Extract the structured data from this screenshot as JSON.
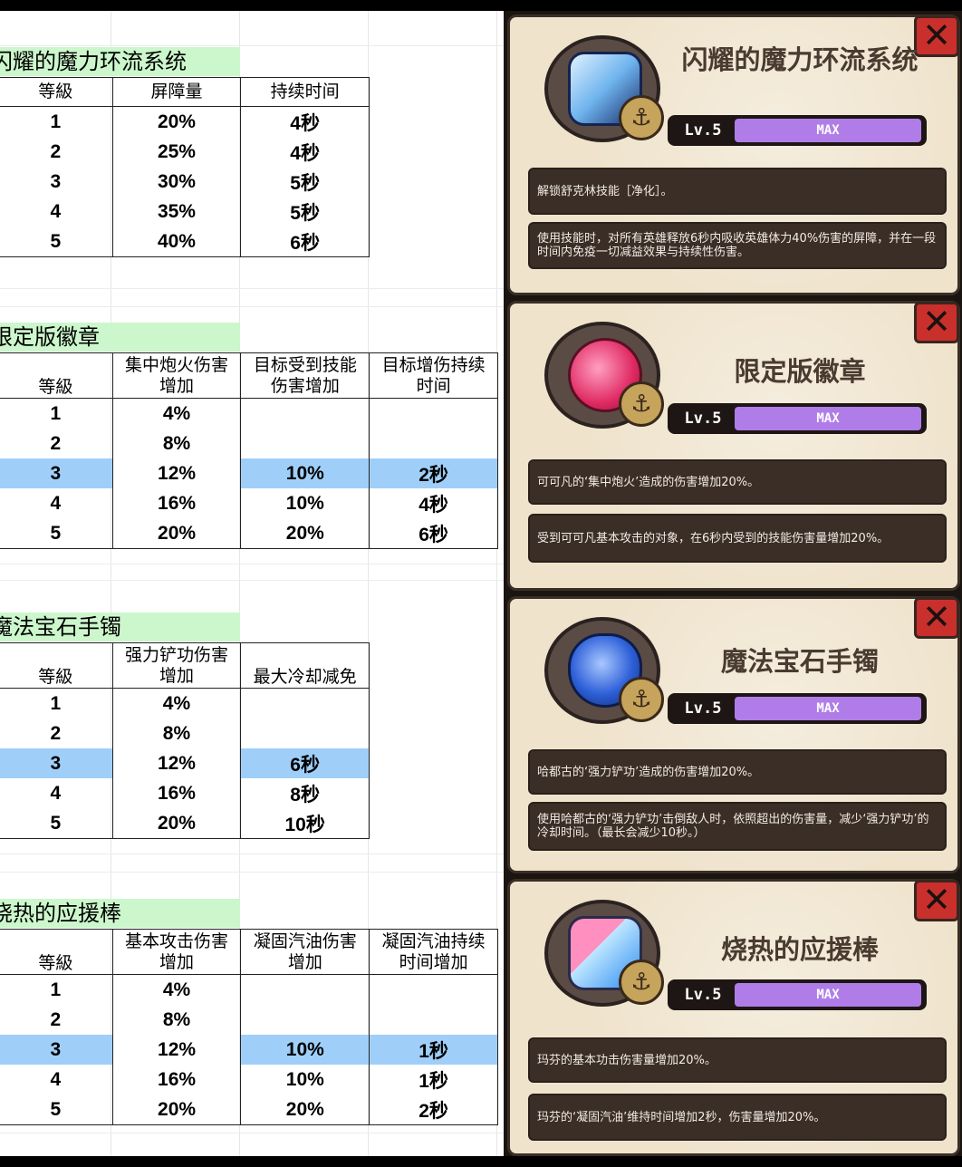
{
  "sections": [
    {
      "title": "闪耀的魔力环流系统",
      "headers": [
        "等級",
        "屏障量",
        "持续时间"
      ],
      "rows": [
        [
          "1",
          "20%",
          "4秒"
        ],
        [
          "2",
          "25%",
          "4秒"
        ],
        [
          "3",
          "30%",
          "5秒"
        ],
        [
          "4",
          "35%",
          "5秒"
        ],
        [
          "5",
          "40%",
          "6秒"
        ]
      ]
    },
    {
      "title": "限定版徽章",
      "headers": [
        "等級",
        "集中炮火伤害\n增加",
        "目标受到技能\n伤害增加",
        "目标增伤持续\n时间"
      ],
      "rows": [
        [
          "1",
          "4%",
          "",
          ""
        ],
        [
          "2",
          "8%",
          "",
          ""
        ],
        [
          "3",
          "12%",
          "10%",
          "2秒"
        ],
        [
          "4",
          "16%",
          "10%",
          "4秒"
        ],
        [
          "5",
          "20%",
          "20%",
          "6秒"
        ]
      ],
      "highlight_row": 2
    },
    {
      "title": "魔法宝石手镯",
      "headers": [
        "等級",
        "强力铲功伤害\n增加",
        "最大冷却减免"
      ],
      "rows": [
        [
          "1",
          "4%",
          ""
        ],
        [
          "2",
          "8%",
          ""
        ],
        [
          "3",
          "12%",
          "6秒"
        ],
        [
          "4",
          "16%",
          "8秒"
        ],
        [
          "5",
          "20%",
          "10秒"
        ]
      ],
      "highlight_row": 2
    },
    {
      "title": "烧热的应援棒",
      "headers": [
        "等級",
        "基本攻击伤害\n增加",
        "凝固汽油伤害\n增加",
        "凝固汽油持续\n时间增加"
      ],
      "rows": [
        [
          "1",
          "4%",
          "",
          ""
        ],
        [
          "2",
          "8%",
          "",
          ""
        ],
        [
          "3",
          "12%",
          "10%",
          "1秒"
        ],
        [
          "4",
          "16%",
          "10%",
          "1秒"
        ],
        [
          "5",
          "20%",
          "20%",
          "2秒"
        ]
      ],
      "highlight_row": 2
    }
  ],
  "cards": [
    {
      "title": "闪耀的魔力环流系统",
      "level": "Lv.5",
      "status": "MAX",
      "close": "✕",
      "desc1": "解锁舒克林技能［净化］。",
      "desc2": "使用技能时，对所有英雄释放6秒内吸收英雄体力40%伤害的屏障，并在一段时间内免疫一切减益效果与持续性伤害。"
    },
    {
      "title": "限定版徽章",
      "level": "Lv.5",
      "status": "MAX",
      "close": "✕",
      "desc1": "可可凡的‘集中炮火’造成的伤害增加20%。",
      "desc2": "受到可可凡基本攻击的对象，在6秒内受到的技能伤害量增加20%。"
    },
    {
      "title": "魔法宝石手镯",
      "level": "Lv.5",
      "status": "MAX",
      "close": "✕",
      "desc1": "哈都古的‘强力铲功’造成的伤害增加20%。",
      "desc2": "使用哈都古的‘强力铲功’击倒敌人时，依照超出的伤害量，减少‘强力铲功’的冷却时间。（最长会减少10秒。）"
    },
    {
      "title": "烧热的应援棒",
      "level": "Lv.5",
      "status": "MAX",
      "close": "✕",
      "desc1": "玛芬的基本功击伤害量增加20%。",
      "desc2": "玛芬的‘凝固汽油’维持时间增加2秒，伤害量增加20%。"
    }
  ],
  "colors": {
    "title_bg": "#ccf7cc",
    "highlight": "#9fcff9",
    "max_bar": "#b07de8",
    "close": "#c9302c"
  }
}
